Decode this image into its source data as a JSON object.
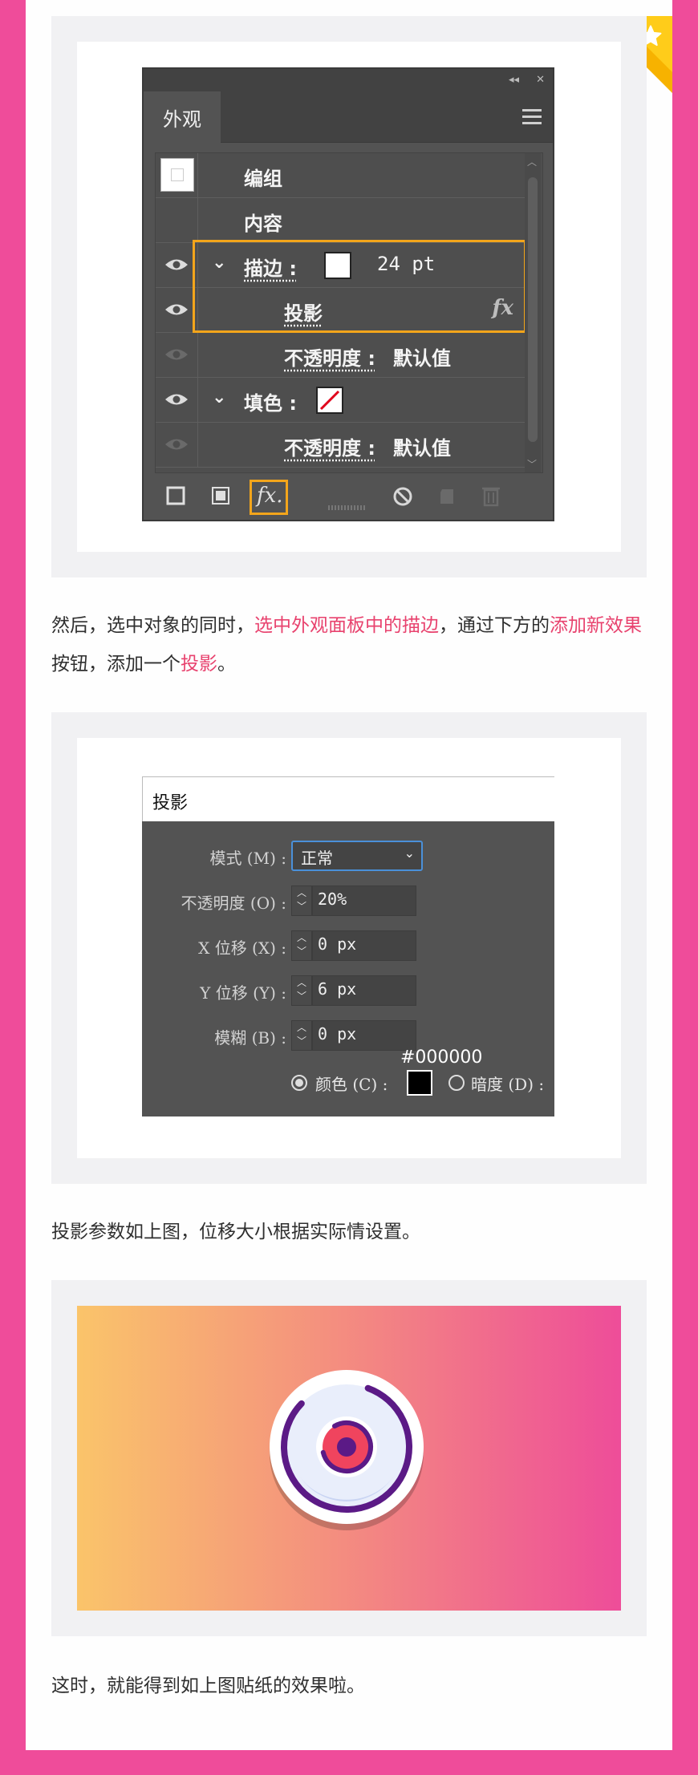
{
  "appearance_panel": {
    "title": "外观",
    "window_controls": [
      "◂◂",
      "✕"
    ],
    "rows": [
      {
        "label": "编组"
      },
      {
        "label": "内容"
      },
      {
        "label": "描边 :",
        "value": "24 pt"
      },
      {
        "label": "投影",
        "fx": "fx"
      },
      {
        "label": "不透明度 :",
        "value": "默认值"
      },
      {
        "label": "填色 :"
      },
      {
        "label": "不透明度 :",
        "value": "默认值"
      }
    ],
    "footer_fx": "fx."
  },
  "paragraph1": {
    "part1": "然后，选中对象的同时，",
    "hl1": "选中外观面板中的描边",
    "part2": "，通过下方的",
    "hl2": "添加新效果",
    "part3": "按钮，添加一个",
    "hl3": "投影",
    "part4": "。"
  },
  "drop_shadow_dialog": {
    "title": "投影",
    "mode_label": "模式 (M) :",
    "mode_value": "正常",
    "opacity_label": "不透明度 (O) :",
    "opacity_value": "20%",
    "x_label": "X 位移 (X) :",
    "x_value": "0 px",
    "y_label": "Y 位移 (Y) :",
    "y_value": "6 px",
    "blur_label": "模糊 (B) :",
    "blur_value": "0 px",
    "color_hex": "#000000",
    "color_label": "颜色 (C) :",
    "darkness_label": "暗度 (D) :"
  },
  "paragraph2": "投影参数如上图，位移大小根据实际情设置。",
  "paragraph3": "这时，就能得到如上图贴纸的效果啦。",
  "colors": {
    "frame_pink": "#ef4c9a",
    "highlight_orange": "#f3a51b",
    "text_highlight": "#e8426e",
    "sticker_purple": "#5b1a86",
    "sticker_red": "#f0445e"
  }
}
